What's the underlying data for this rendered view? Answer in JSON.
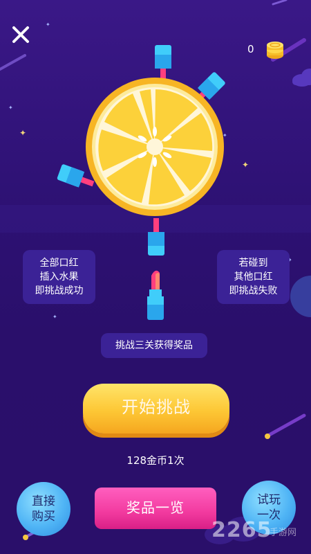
{
  "header": {
    "close_icon": "close-icon",
    "coin_count": "0",
    "coin_icon": "coin-stack-icon"
  },
  "game": {
    "fruit": "lemon-slice",
    "inserted_lipsticks": 4,
    "remaining_lipsticks": 1
  },
  "instructions": {
    "left_line1": "全部口红",
    "left_line2": "插入水果",
    "left_line3": "即挑战成功",
    "right_line1": "若碰到",
    "right_line2": "其他口红",
    "right_line3": "即挑战失败",
    "challenge_note": "挑战三关获得奖品"
  },
  "actions": {
    "start_label": "开始挑战",
    "cost_text": "128金币1次",
    "buy_line1": "直接",
    "buy_line2": "购买",
    "prizes_label": "奖品一览",
    "trial_line1": "试玩",
    "trial_line2": "一次"
  },
  "watermark": {
    "text": "2265",
    "subtext": "手游网"
  },
  "colors": {
    "background": "#2d1173",
    "panel": "#3b2296",
    "start_button": "#fdc735",
    "prizes_button": "#f23a9f",
    "circle_buttons": "#4fb4f5",
    "lipstick_case": "#3cc5f5",
    "lipstick_color": "#ff3f7e",
    "lemon": "#fcd13a"
  }
}
